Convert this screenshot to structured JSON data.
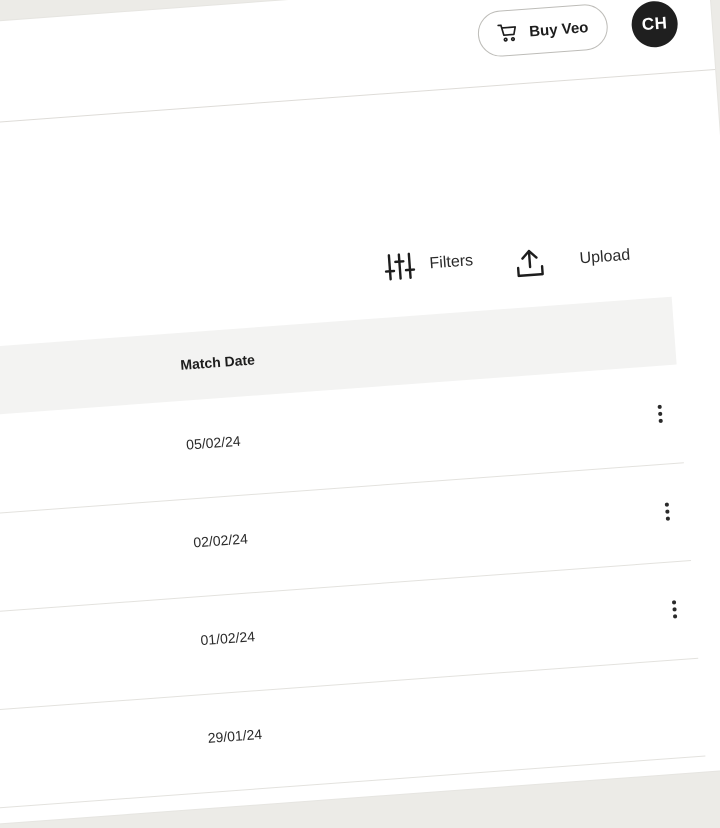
{
  "header": {
    "buy_label": "Buy Veo",
    "avatar_initials": "CH"
  },
  "toolbar": {
    "filters_label": "Filters",
    "upload_label": "Upload"
  },
  "table": {
    "column_header": "Match Date",
    "rows": [
      {
        "date": "05/02/24"
      },
      {
        "date": "02/02/24"
      },
      {
        "date": "01/02/24"
      },
      {
        "date": "29/01/24"
      }
    ]
  },
  "icons": {
    "cart": "cart-icon",
    "filters": "sliders-icon",
    "upload": "upload-icon",
    "more": "more-vertical-icon"
  }
}
